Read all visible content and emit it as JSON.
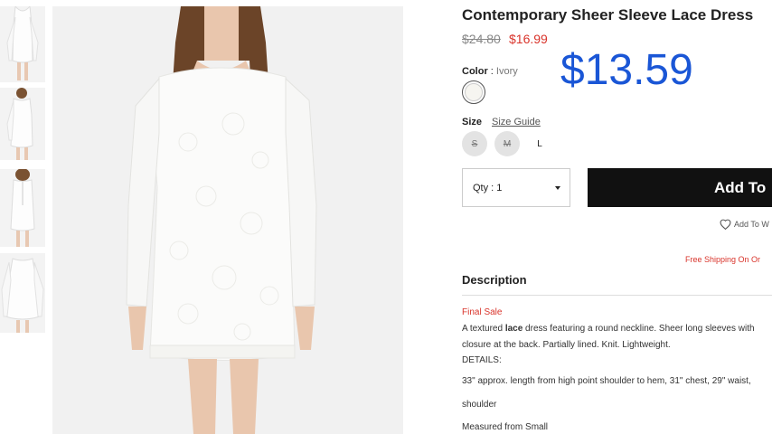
{
  "product": {
    "title": "Contemporary Sheer Sleeve Lace Dress",
    "original_price": "$24.80",
    "sale_price": "$16.99",
    "overlay_price": "$13.59"
  },
  "color": {
    "label": "Color",
    "separator": ":",
    "value": "Ivory"
  },
  "size": {
    "label": "Size",
    "guide_label": "Size Guide",
    "options": [
      {
        "label": "S",
        "available": false
      },
      {
        "label": "M",
        "available": false
      },
      {
        "label": "L",
        "available": true
      }
    ]
  },
  "qty": {
    "label": "Qty : 1"
  },
  "add_button": {
    "label": "Add To"
  },
  "wishlist": {
    "label": "Add To W",
    "icon": "heart-icon"
  },
  "free_shipping": "Free Shipping On Or",
  "description": {
    "heading": "Description",
    "final_sale": "Final Sale",
    "line1_pre": "A textured ",
    "line1_bold": "lace",
    "line1_post": " dress featuring a round neckline. Sheer long sleeves with",
    "line2": "closure at the back. Partially lined. Knit. Lightweight.",
    "details_label": "DETAILS:",
    "line3": "33\" approx. length from high point shoulder to hem, 31\" chest, 29\" waist,",
    "line4": "shoulder",
    "line5": "Measured from Small"
  },
  "colors": {
    "sale": "#d9342b",
    "overlay_price": "#1a56d6",
    "add_button_bg": "#111111"
  }
}
